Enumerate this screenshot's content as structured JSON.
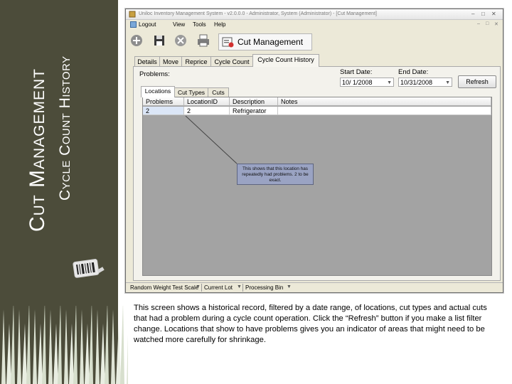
{
  "slide": {
    "title": "Cut Management",
    "subtitle": "Cycle Count History",
    "caption": "This screen shows a historical record, filtered by a date range, of locations, cut types and actual cuts that had a problem during a cycle count operation. Click the “Refresh” button if you make a list filter change. Locations that show to have problems gives you an indicator of areas that might need to be watched more carefully for shrinkage."
  },
  "window": {
    "title": "Uniloc Inventory Management System - v2.0.0.0 - Administrator, System (Administrator) - [Cut Management]",
    "controls": [
      "–",
      "□",
      "✕"
    ]
  },
  "menu": {
    "items": [
      "Logout",
      "View",
      "Tools",
      "Help"
    ],
    "right_controls": [
      "–",
      "□",
      "✕"
    ]
  },
  "toolbar": {
    "buttons": [
      "add-icon",
      "save-icon",
      "delete-icon",
      "print-icon",
      "module-icon"
    ],
    "module_title": "Cut Management"
  },
  "tabs": [
    "Details",
    "Move",
    "Reprice",
    "Cycle Count",
    "Cycle Count History"
  ],
  "active_tab": "Cycle Count History",
  "filters": {
    "problems_label": "Problems:",
    "start_label": "Start Date:",
    "start_value": "10/  1/2008",
    "end_label": "End Date:",
    "end_value": "10/31/2008",
    "refresh_label": "Refresh"
  },
  "subtabs": [
    "Locations",
    "Cut Types",
    "Cuts"
  ],
  "grid": {
    "columns": [
      "Problems",
      "LocationID",
      "Description",
      "Notes"
    ],
    "rows": [
      {
        "problems": "2",
        "location_id": "2",
        "description": "Refrigerator",
        "notes": ""
      }
    ]
  },
  "callout": {
    "text": "This shows that this location has repeatedly had problems. 2 to be exact."
  },
  "statusbar": {
    "items": [
      "Random Weight Test Scale",
      "Current Lot",
      "Processing Bin"
    ]
  },
  "colors": {
    "sidebar": "#4c4c3a",
    "callout": "#9aa3c3",
    "grid_background": "#a3a3a3",
    "window_chrome": "#ece9d8"
  }
}
